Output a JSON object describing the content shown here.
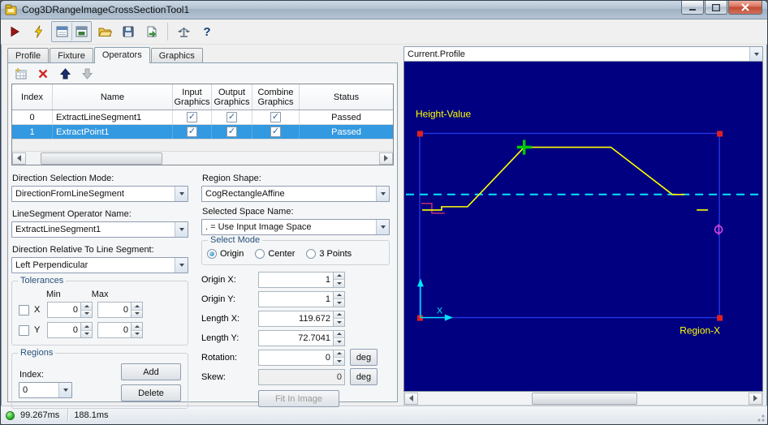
{
  "window": {
    "title": "Cog3DRangeImageCrossSectionTool1"
  },
  "colors": {
    "selection": "#3399e0",
    "display_background": "#000080",
    "profile_line": "#ffff00",
    "crosshair": "#00e5ff",
    "region_border": "#2233dd",
    "status_ok": "#2db52d"
  },
  "tabs": {
    "items": [
      {
        "label": "Profile"
      },
      {
        "label": "Fixture"
      },
      {
        "label": "Operators"
      },
      {
        "label": "Graphics"
      }
    ],
    "active": "Operators"
  },
  "operators_table": {
    "columns": [
      {
        "label": "Index"
      },
      {
        "label": "Name"
      },
      {
        "label": "Input Graphics"
      },
      {
        "label": "Output Graphics"
      },
      {
        "label": "Combine Graphics"
      },
      {
        "label": "Status"
      }
    ],
    "rows": [
      {
        "index": "0",
        "name": "ExtractLineSegment1",
        "input_graphics": true,
        "output_graphics": true,
        "combine_graphics": true,
        "status": "Passed",
        "selected": false
      },
      {
        "index": "1",
        "name": "ExtractPoint1",
        "input_graphics": true,
        "output_graphics": true,
        "combine_graphics": true,
        "status": "Passed",
        "selected": true
      }
    ]
  },
  "direction_form": {
    "mode_label": "Direction Selection Mode:",
    "mode_value": "DirectionFromLineSegment",
    "operator_label": "LineSegment Operator Name:",
    "operator_value": "ExtractLineSegment1",
    "relative_label": "Direction Relative To Line Segment:",
    "relative_value": "Left Perpendicular"
  },
  "tolerances": {
    "title": "Tolerances",
    "min_header": "Min",
    "max_header": "Max",
    "rows": [
      {
        "label": "X",
        "checked": false,
        "min": "0",
        "max": "0"
      },
      {
        "label": "Y",
        "checked": false,
        "min": "0",
        "max": "0"
      }
    ]
  },
  "regions": {
    "title": "Regions",
    "index_label": "Index:",
    "index_value": "0",
    "add_label": "Add",
    "delete_label": "Delete"
  },
  "region_form": {
    "shape_label": "Region Shape:",
    "shape_value": "CogRectangleAffine",
    "space_label": "Selected Space Name:",
    "space_value": ". = Use Input Image Space",
    "select_mode": {
      "title": "Select Mode",
      "options": [
        {
          "label": "Origin",
          "selected": true
        },
        {
          "label": "Center",
          "selected": false
        },
        {
          "label": "3 Points",
          "selected": false
        }
      ]
    },
    "fields": [
      {
        "label": "Origin X:",
        "value": "1"
      },
      {
        "label": "Origin Y:",
        "value": "1"
      },
      {
        "label": "Length X:",
        "value": "119.672"
      },
      {
        "label": "Length Y:",
        "value": "72.7041"
      },
      {
        "label": "Rotation:",
        "value": "0",
        "unit": "deg"
      },
      {
        "label": "Skew:",
        "value": "0",
        "unit": "deg"
      }
    ],
    "fit_button_label": "Fit In Image"
  },
  "display": {
    "selector_value": "Current.Profile",
    "y_axis_label": "Height-Value",
    "x_axis_label": "Region-X"
  },
  "status_bar": {
    "time_primary": "99.267ms",
    "time_secondary": "188.1ms"
  }
}
